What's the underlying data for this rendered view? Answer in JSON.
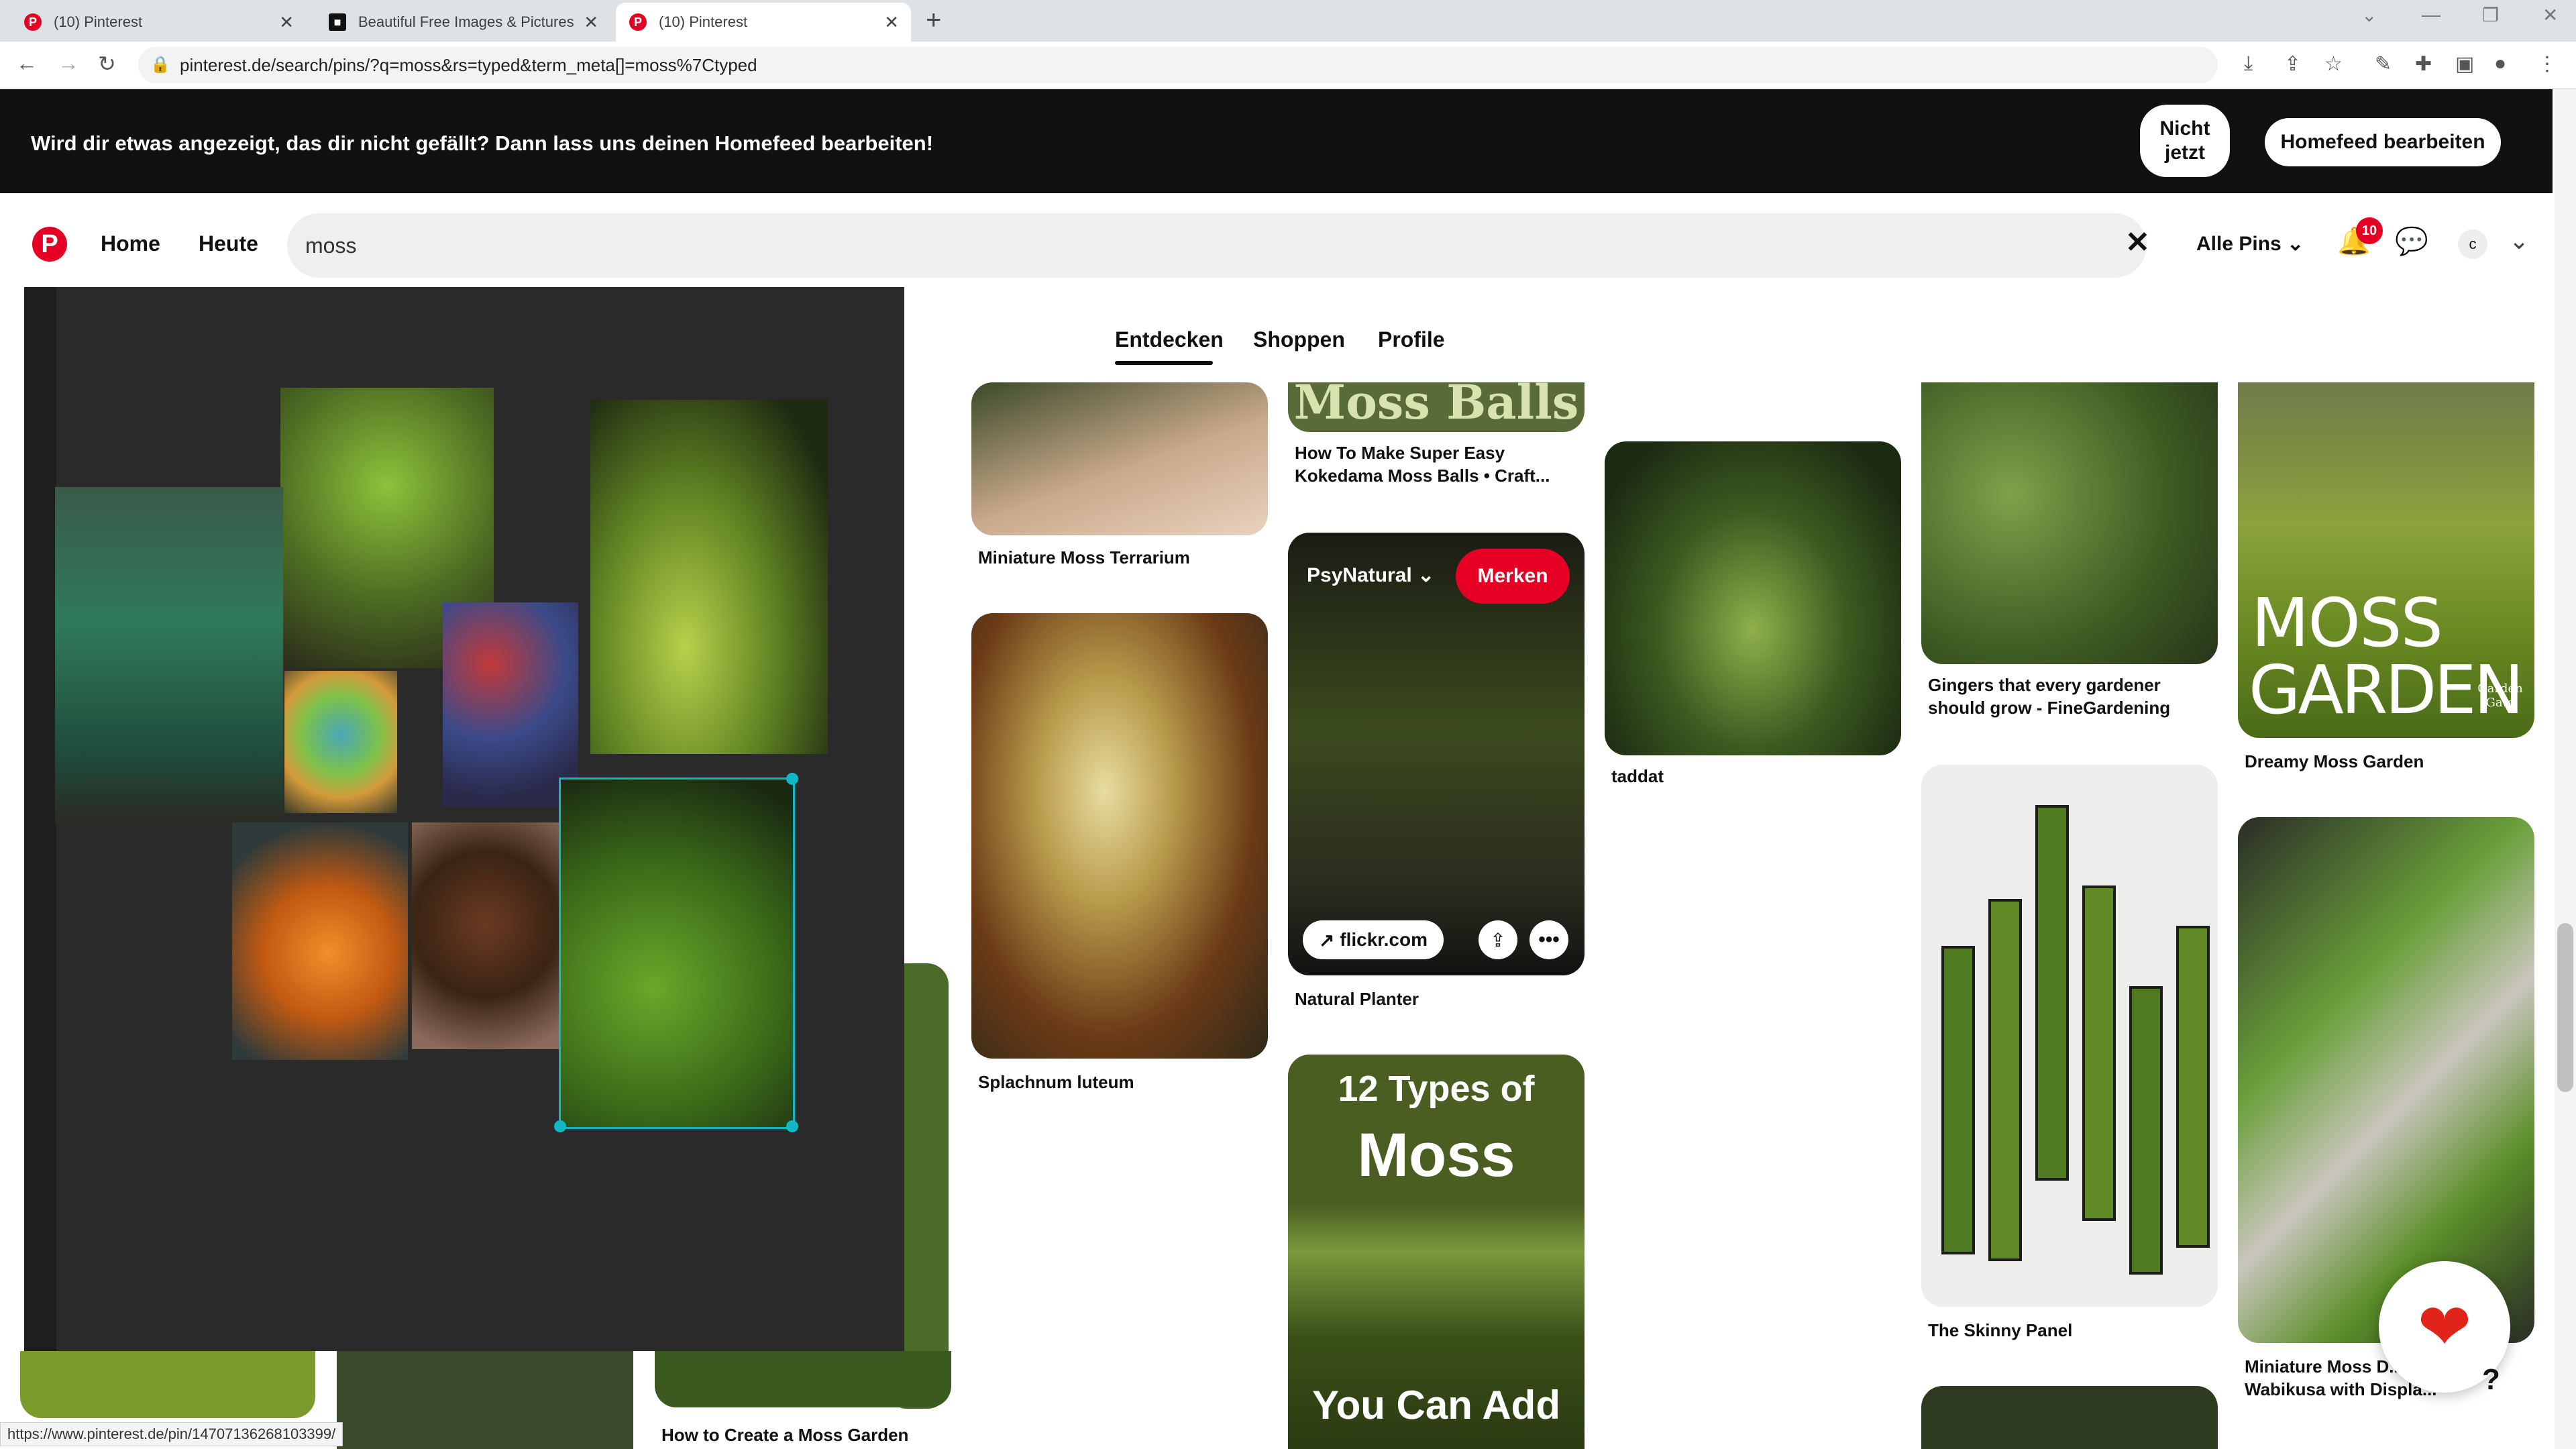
{
  "browser": {
    "tabs": [
      {
        "title": "(10) Pinterest"
      },
      {
        "title": "Beautiful Free Images & Pictures"
      },
      {
        "title": "(10) Pinterest"
      }
    ],
    "url": "pinterest.de/search/pins/?q=moss&rs=typed&term_meta[]=moss%7Ctyped",
    "status_url": "https://www.pinterest.de/pin/14707136268103399/"
  },
  "banner": {
    "text": "Wird dir etwas angezeigt, das dir nicht gefällt? Dann lass uns deinen Homefeed bearbeiten!",
    "not_now_line1": "Nicht",
    "not_now_line2": "jetzt",
    "edit_button": "Homefeed bearbeiten"
  },
  "header": {
    "home": "Home",
    "today": "Heute",
    "search_value": "moss",
    "filter": "Alle Pins",
    "notifications": "10",
    "avatar_letter": "c"
  },
  "tabs": [
    "Entdecken",
    "Shoppen",
    "Profile"
  ],
  "pins": {
    "miniature_terrarium": "Miniature Moss Terrarium",
    "kokedama": "How To Make Super Easy Kokedama Moss Balls • Craft...",
    "kokedama_banner": "Moss Balls",
    "psy_user": "PsyNatural",
    "save": "Merken",
    "source": "flickr.com",
    "natural_planter": "Natural Planter",
    "splachnum": "Splachnum luteum",
    "twelve_l1": "12 Types of",
    "twelve_l2": "Moss",
    "twelve_l3": "You Can Add",
    "taddat": "taddat",
    "gingers_l1": "Gingers that every gardener",
    "gingers_l2": "should grow - FineGardening",
    "skinny": "The Skinny Panel",
    "dreamy": "Dreamy Moss Garden",
    "moss_word": "MOSS",
    "garden_word": "GARDEN",
    "garden_gate": "Garden Gate",
    "mini_l1": "Miniature Moss D...",
    "mini_l2": "Wabikusa with Displa...",
    "create_garden": "How to Create a Moss Garden"
  }
}
